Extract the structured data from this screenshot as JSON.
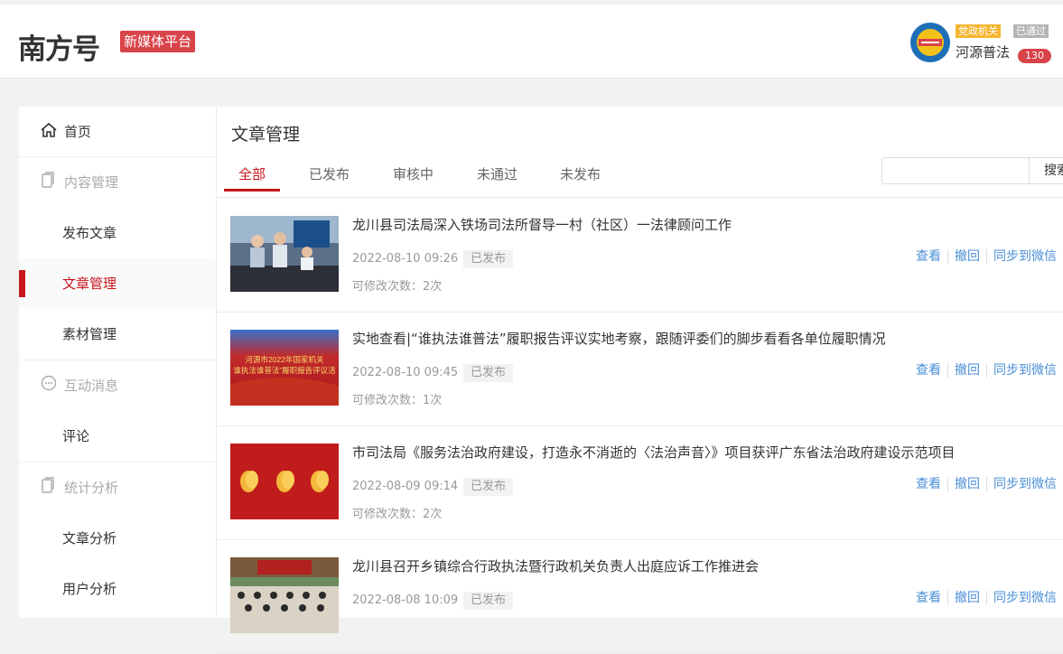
{
  "header": {
    "logo": "南方号",
    "platform": "新媒体平台",
    "user": {
      "name": "河源普法",
      "tag_gov": "党政机关",
      "tag_status": "已通过",
      "count": "130"
    }
  },
  "sidebar": {
    "home": "首页",
    "content_group": "内容管理",
    "publish": "发布文章",
    "manage": "文章管理",
    "material": "素材管理",
    "interact_group": "互动消息",
    "comment": "评论",
    "stats_group": "统计分析",
    "article_analysis": "文章分析",
    "user_analysis": "用户分析"
  },
  "main": {
    "title": "文章管理",
    "tabs": [
      "全部",
      "已发布",
      "审核中",
      "未通过",
      "未发布"
    ],
    "search_button": "搜索",
    "search_placeholder": ""
  },
  "articles": [
    {
      "title": "龙川县司法局深入铁场司法所督导一村（社区）一法律顾问工作",
      "date": "2022-08-10 09:26",
      "status": "已发布",
      "edits": "可修改次数：2次"
    },
    {
      "title": "实地查看|“谁执法谁普法”履职报告评议实地考察，跟随评委们的脚步看看各单位履职情况",
      "date": "2022-08-10 09:45",
      "status": "已发布",
      "edits": "可修改次数：1次",
      "thumb_text_1": "河源市2022年国家机关",
      "thumb_text_2": "谁执法谁普法”履职报告评议活"
    },
    {
      "title": "市司法局《服务法治政府建设，打造永不消逝的〈法治声音〉》项目获评广东省法治政府建设示范项目",
      "date": "2022-08-09 09:14",
      "status": "已发布",
      "edits": "可修改次数：2次"
    },
    {
      "title": "龙川县召开乡镇综合行政执法暨行政机关负责人出庭应诉工作推进会",
      "date": "2022-08-08 10:09",
      "status": "已发布",
      "edits": ""
    }
  ],
  "actions": {
    "view": "查看",
    "revoke": "撤回",
    "sync": "同步到微信"
  },
  "colors": {
    "brand_red": "#c8161d",
    "badge_red": "#d9434a",
    "link_blue": "#4b8fd6",
    "gov_yellow": "#f5b52e"
  }
}
